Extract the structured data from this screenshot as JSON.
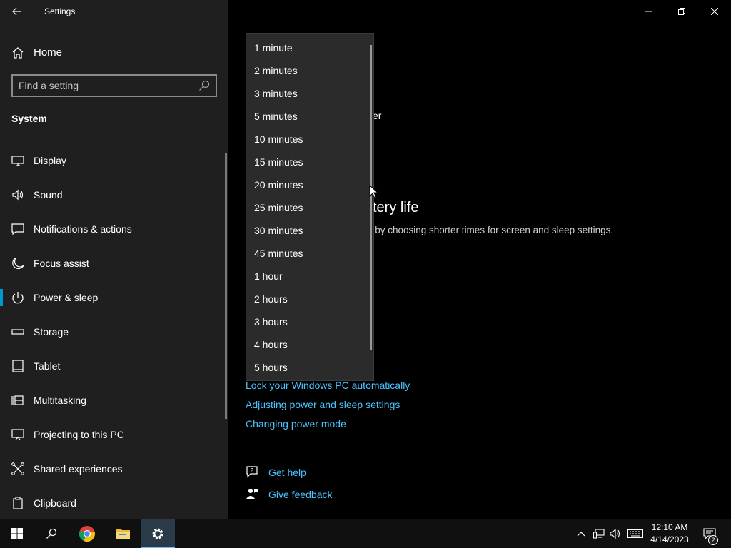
{
  "window": {
    "title": "Settings"
  },
  "sidebar": {
    "home_label": "Home",
    "search_placeholder": "Find a setting",
    "section_title": "System",
    "items": [
      {
        "label": "Display",
        "icon": "monitor-icon"
      },
      {
        "label": "Sound",
        "icon": "speaker-icon"
      },
      {
        "label": "Notifications & actions",
        "icon": "message-icon"
      },
      {
        "label": "Focus assist",
        "icon": "moon-icon"
      },
      {
        "label": "Power & sleep",
        "icon": "power-icon",
        "active": true
      },
      {
        "label": "Storage",
        "icon": "drive-icon"
      },
      {
        "label": "Tablet",
        "icon": "tablet-icon"
      },
      {
        "label": "Multitasking",
        "icon": "multitask-icon"
      },
      {
        "label": "Projecting to this PC",
        "icon": "project-icon"
      },
      {
        "label": "Shared experiences",
        "icon": "share-icon"
      },
      {
        "label": "Clipboard",
        "icon": "clipboard-icon"
      }
    ]
  },
  "main": {
    "fragment_text": "er",
    "fragment_heading": "tery life",
    "fragment_description": "r by choosing shorter times for screen and sleep settings.",
    "related_links": [
      "Lock your Windows PC automatically",
      "Adjusting power and sleep settings",
      "Changing power mode"
    ],
    "help": {
      "get_help": "Get help",
      "give_feedback": "Give feedback"
    }
  },
  "dropdown": {
    "options": [
      "1 minute",
      "2 minutes",
      "3 minutes",
      "5 minutes",
      "10 minutes",
      "15 minutes",
      "20 minutes",
      "25 minutes",
      "30 minutes",
      "45 minutes",
      "1 hour",
      "2 hours",
      "3 hours",
      "4 hours",
      "5 hours"
    ]
  },
  "taskbar": {
    "apps": [
      "start-icon",
      "search-icon",
      "chrome-icon",
      "file-explorer-icon",
      "settings-icon"
    ],
    "clock": {
      "time": "12:10 AM",
      "date": "4/14/2023"
    },
    "notification_count": "2"
  },
  "colors": {
    "accent": "#0099cc",
    "link": "#4cc2ff",
    "sidebar_bg": "#1f1f1f",
    "dropdown_bg": "#2b2b2b"
  }
}
